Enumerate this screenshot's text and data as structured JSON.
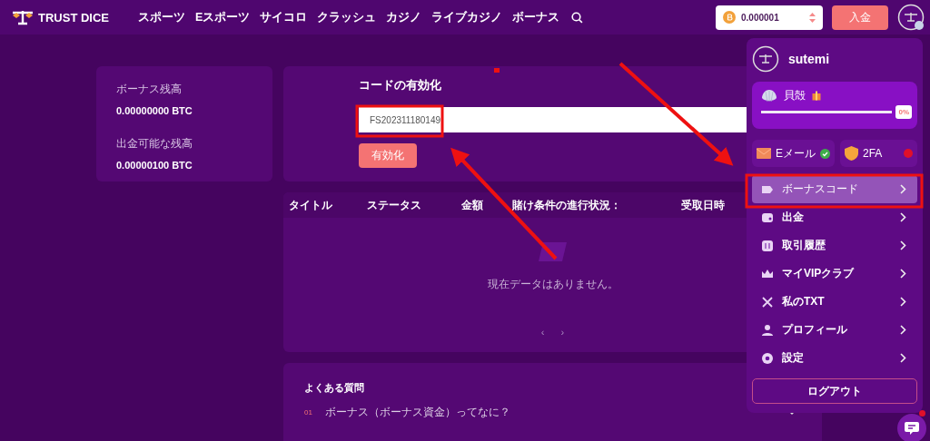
{
  "header": {
    "logo": "TRUST DICE",
    "nav": [
      "スポーツ",
      "Eスポーツ",
      "サイコロ",
      "クラッシュ",
      "カジノ",
      "ライブカジノ",
      "ボーナス"
    ],
    "balance": "0.000001",
    "deposit": "入金"
  },
  "balances": [
    {
      "label": "ボーナス残高",
      "value": "0.00000000 BTC"
    },
    {
      "label": "出金可能な残高",
      "value": "0.00000100 BTC"
    }
  ],
  "code_form": {
    "title": "コードの有効化",
    "value": "FS202311180149",
    "button": "有効化"
  },
  "table": {
    "columns": [
      "タイトル",
      "ステータス",
      "金額",
      "賭け条件の進行状況：",
      "受取日時"
    ],
    "empty_text": "現在データはありません。",
    "pager": [
      "‹",
      "›"
    ]
  },
  "faq": {
    "title": "よくある質問",
    "items": [
      {
        "number": "01",
        "question": "ボーナス（ボーナス資金）ってなに？",
        "expanded": false
      }
    ]
  },
  "user_menu": {
    "username": "sutemi",
    "vip": {
      "rank": "貝殻",
      "level": 0,
      "percent": "0%"
    },
    "security": [
      {
        "label": "Eメール",
        "verified": true
      },
      {
        "label": "2FA",
        "verified": false
      }
    ],
    "items": [
      {
        "label": "ボーナスコード",
        "selected": true
      },
      {
        "label": "出金",
        "selected": false
      },
      {
        "label": "取引履歴",
        "selected": false
      },
      {
        "label": "マイVIPクラブ",
        "selected": false
      },
      {
        "label": "私のTXT",
        "selected": false
      },
      {
        "label": "プロフィール",
        "selected": false
      },
      {
        "label": "設定",
        "selected": false
      }
    ],
    "logout": "ログアウト"
  },
  "chat": {
    "unread": true
  }
}
